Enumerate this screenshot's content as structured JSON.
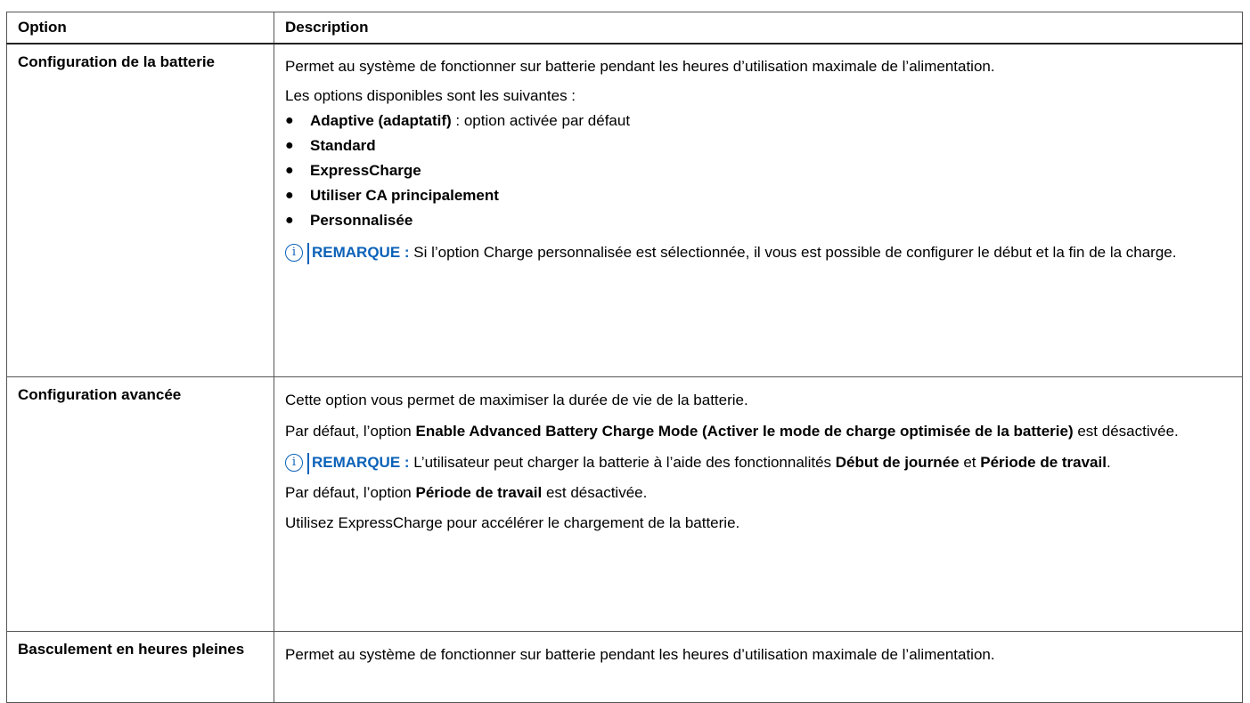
{
  "table": {
    "headers": {
      "option": "Option",
      "description": "Description"
    },
    "rows": [
      {
        "option": "Configuration de la batterie",
        "p1": "Permet au système de fonctionner sur batterie pendant les heures d’utilisation maximale de l’alimentation.",
        "p2": "Les options disponibles sont les suivantes :",
        "bullets": [
          {
            "bold": "Adaptive (adaptatif)",
            "rest": " : option activée par défaut"
          },
          {
            "bold": "Standard",
            "rest": ""
          },
          {
            "bold": "ExpressCharge",
            "rest": ""
          },
          {
            "bold": "Utiliser CA principalement",
            "rest": ""
          },
          {
            "bold": "Personnalisée",
            "rest": ""
          }
        ],
        "bullet_symbol": "●",
        "note": {
          "label": "REMARQUE :",
          "text": " Si l’option Charge personnalisée est sélectionnée, il vous est possible de configurer le début et la fin de la charge."
        }
      },
      {
        "option": "Configuration avancée",
        "p1": "Cette option vous permet de maximiser la durée de vie de la batterie.",
        "p2_a": "Par défaut, l’option ",
        "p2_b": "Enable Advanced Battery Charge Mode (Activer le mode de charge optimisée de la batterie)",
        "p2_c": " est désactivée.",
        "note": {
          "label": "REMARQUE :",
          "text_a": " L’utilisateur peut charger la batterie à l’aide des fonctionnalités ",
          "text_b": "Début de journée",
          "text_c": " et ",
          "text_d": "Période de travail",
          "text_e": "."
        },
        "p3_a": "Par défaut, l’option ",
        "p3_b": "Période de travail",
        "p3_c": " est désactivée.",
        "p4": "Utilisez ExpressCharge pour accélérer le chargement de la batterie."
      },
      {
        "option": "Basculement en heures pleines",
        "p1": "Permet au système de fonctionner sur batterie pendant les heures d’utilisation maximale de l’alimentation."
      }
    ]
  },
  "icons": {
    "note_icon": "info-circle-icon",
    "note_glyph": "i"
  },
  "colors": {
    "note_accent": "#0b62b8",
    "border": "#555555"
  }
}
